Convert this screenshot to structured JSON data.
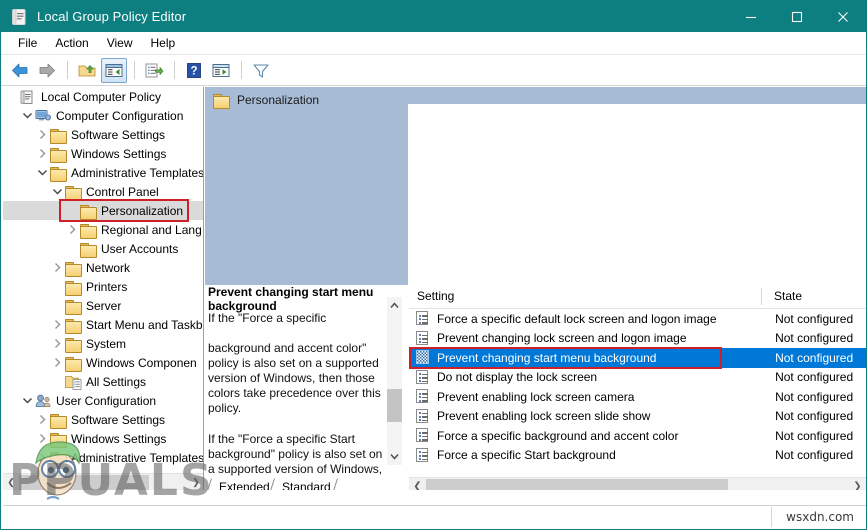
{
  "window": {
    "title": "Local Group Policy Editor",
    "icon": "policy-editor-icon",
    "titlebar_color": "#0d7f80",
    "controls": {
      "minimize": "minimize-button",
      "maximize": "maximize-button",
      "close": "close-button"
    }
  },
  "menubar": {
    "items": [
      "File",
      "Action",
      "View",
      "Help"
    ]
  },
  "toolbar": {
    "buttons": [
      {
        "name": "back-icon",
        "label": "Back"
      },
      {
        "name": "forward-icon",
        "label": "Forward"
      },
      {
        "name": "up-one-level-icon",
        "label": "Up One Level"
      },
      {
        "name": "show-hide-console-tree-icon",
        "label": "Show/Hide Console Tree",
        "active": true
      },
      {
        "name": "export-list-icon",
        "label": "Export List"
      },
      {
        "name": "help-icon",
        "label": "Help"
      },
      {
        "name": "properties-icon",
        "label": "Properties"
      },
      {
        "name": "filter-icon",
        "label": "Filter On/Off"
      }
    ]
  },
  "tree": {
    "nodes": [
      {
        "label": "Local Computer Policy",
        "indent": 0,
        "twisty": "none",
        "icon": "policy-scroll-icon"
      },
      {
        "label": "Computer Configuration",
        "indent": 1,
        "twisty": "expanded",
        "icon": "computer-icon"
      },
      {
        "label": "Software Settings",
        "indent": 2,
        "twisty": "collapsed",
        "icon": "folder-icon"
      },
      {
        "label": "Windows Settings",
        "indent": 2,
        "twisty": "collapsed",
        "icon": "folder-icon"
      },
      {
        "label": "Administrative Templates",
        "indent": 2,
        "twisty": "expanded",
        "icon": "folder-icon"
      },
      {
        "label": "Control Panel",
        "indent": 3,
        "twisty": "expanded",
        "icon": "folder-icon"
      },
      {
        "label": "Personalization",
        "indent": 4,
        "twisty": "none",
        "icon": "folder-icon",
        "highlighted": true
      },
      {
        "label": "Regional and Lang",
        "indent": 4,
        "twisty": "collapsed",
        "icon": "folder-icon"
      },
      {
        "label": "User Accounts",
        "indent": 4,
        "twisty": "none",
        "icon": "folder-icon"
      },
      {
        "label": "Network",
        "indent": 3,
        "twisty": "collapsed",
        "icon": "folder-icon"
      },
      {
        "label": "Printers",
        "indent": 3,
        "twisty": "none",
        "icon": "folder-icon"
      },
      {
        "label": "Server",
        "indent": 3,
        "twisty": "none",
        "icon": "folder-icon"
      },
      {
        "label": "Start Menu and Taskb",
        "indent": 3,
        "twisty": "collapsed",
        "icon": "folder-icon"
      },
      {
        "label": "System",
        "indent": 3,
        "twisty": "collapsed",
        "icon": "folder-icon"
      },
      {
        "label": "Windows Componen",
        "indent": 3,
        "twisty": "collapsed",
        "icon": "folder-icon"
      },
      {
        "label": "All Settings",
        "indent": 3,
        "twisty": "none",
        "icon": "all-settings-icon"
      },
      {
        "label": "User Configuration",
        "indent": 1,
        "twisty": "expanded",
        "icon": "user-icon"
      },
      {
        "label": "Software Settings",
        "indent": 2,
        "twisty": "collapsed",
        "icon": "folder-icon"
      },
      {
        "label": "Windows Settings",
        "indent": 2,
        "twisty": "collapsed",
        "icon": "folder-icon"
      },
      {
        "label": "Administrative Templates",
        "indent": 2,
        "twisty": "collapsed",
        "icon": "folder-icon"
      }
    ],
    "highlight_color": "#cf2027"
  },
  "content_header": {
    "title": "Personalization",
    "icon": "folder-icon",
    "background_color": "#a7bbd4"
  },
  "description": {
    "title": "Prevent changing start menu background",
    "clipped_line": "If the \"Force a specific",
    "paragraphs": [
      "background and accent color\" policy is also set on a supported version of Windows, then those colors take precedence over this policy.",
      "If the \"Force a specific Start background\" policy is also set on a supported version of Windows, then that background takes precedence over this policy."
    ]
  },
  "tabs": {
    "items": [
      "Extended",
      "Standard"
    ],
    "active": "Standard"
  },
  "list": {
    "columns": [
      "Setting",
      "State"
    ],
    "rows": [
      {
        "setting": "Force a specific default lock screen and logon image",
        "state": "Not configured",
        "icon": "policy-setting-icon",
        "selected": false
      },
      {
        "setting": "Prevent changing lock screen and logon image",
        "state": "Not configured",
        "icon": "policy-setting-icon",
        "selected": false
      },
      {
        "setting": "Prevent changing start menu background",
        "state": "Not configured",
        "icon": "policy-setting-icon",
        "selected": true
      },
      {
        "setting": "Do not display the lock screen",
        "state": "Not configured",
        "icon": "policy-setting-icon",
        "selected": false
      },
      {
        "setting": "Prevent enabling lock screen camera",
        "state": "Not configured",
        "icon": "policy-setting-icon",
        "selected": false
      },
      {
        "setting": "Prevent enabling lock screen slide show",
        "state": "Not configured",
        "icon": "policy-setting-icon",
        "selected": false
      },
      {
        "setting": "Force a specific background and accent color",
        "state": "Not configured",
        "icon": "policy-setting-icon",
        "selected": false
      },
      {
        "setting": "Force a specific Start background",
        "state": "Not configured",
        "icon": "policy-setting-icon",
        "selected": false
      }
    ],
    "selection_color": "#0078d7",
    "highlight_box_color": "#cf2027"
  },
  "statusbar": {
    "right_text": "wsxdn.com"
  },
  "watermark": {
    "text": "PPUALS"
  }
}
